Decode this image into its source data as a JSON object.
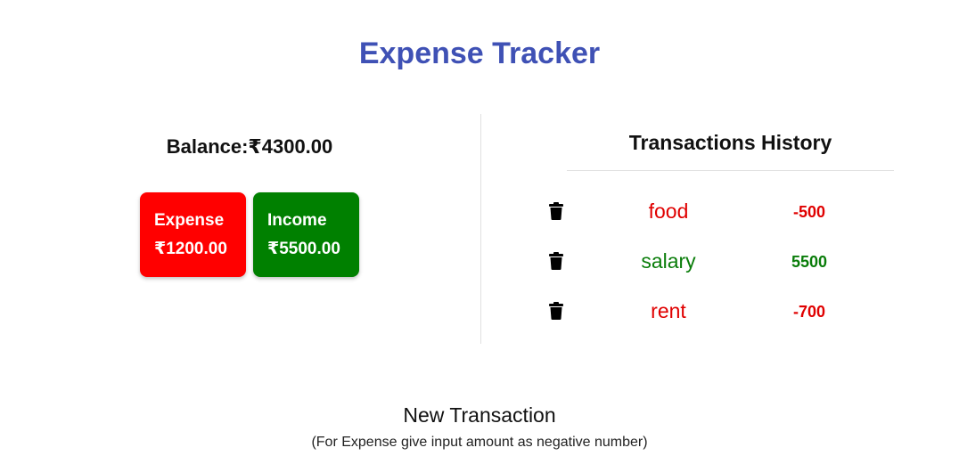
{
  "header": {
    "title": "Expense Tracker"
  },
  "summary": {
    "balance_label": "Balance:₹4300.00",
    "expense": {
      "label": "Expense",
      "amount": "₹1200.00",
      "color": "#ff0000"
    },
    "income": {
      "label": "Income",
      "amount": "₹5500.00",
      "color": "#008000"
    }
  },
  "history": {
    "title": "Transactions History",
    "items": [
      {
        "name": "food",
        "amount": "-500",
        "type": "expense",
        "icon": "trash-icon"
      },
      {
        "name": "salary",
        "amount": "5500",
        "type": "income",
        "icon": "trash-icon"
      },
      {
        "name": "rent",
        "amount": "-700",
        "type": "expense",
        "icon": "trash-icon"
      }
    ]
  },
  "new_transaction": {
    "title": "New Transaction",
    "hint": "(For Expense give input amount as negative number)"
  },
  "colors": {
    "title": "#3f51b5",
    "negative": "#e00000",
    "positive": "#0a7d0a"
  }
}
